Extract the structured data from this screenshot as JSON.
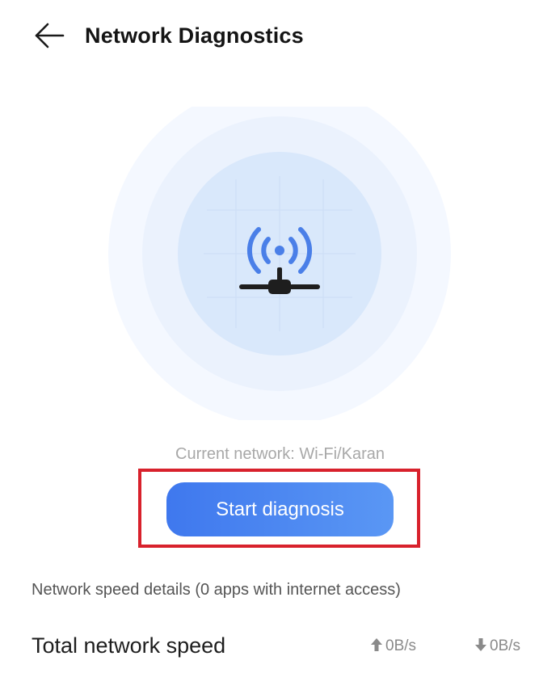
{
  "header": {
    "back_icon": "arrow-left-icon",
    "title": "Network Diagnostics"
  },
  "hero": {
    "icon": "wifi-router-icon",
    "colors": {
      "outer_ring": "#f4f8ff",
      "middle_ring": "#e9f1fd",
      "inner_circle": "#d9e8fb",
      "signal_blue": "#4a7fe8",
      "antenna_dark": "#1e1e1e"
    }
  },
  "network": {
    "current": "Current network: Wi-Fi/Karan"
  },
  "action": {
    "start_label": "Start diagnosis",
    "highlight_color": "#d8212c",
    "button_color": "#4a85f0"
  },
  "details": {
    "speed_details": "Network speed details (0 apps with internet access)",
    "total_label": "Total network speed",
    "upload_icon": "arrow-up-icon",
    "upload_value": "0B/s",
    "download_icon": "arrow-down-icon",
    "download_value": "0B/s"
  }
}
